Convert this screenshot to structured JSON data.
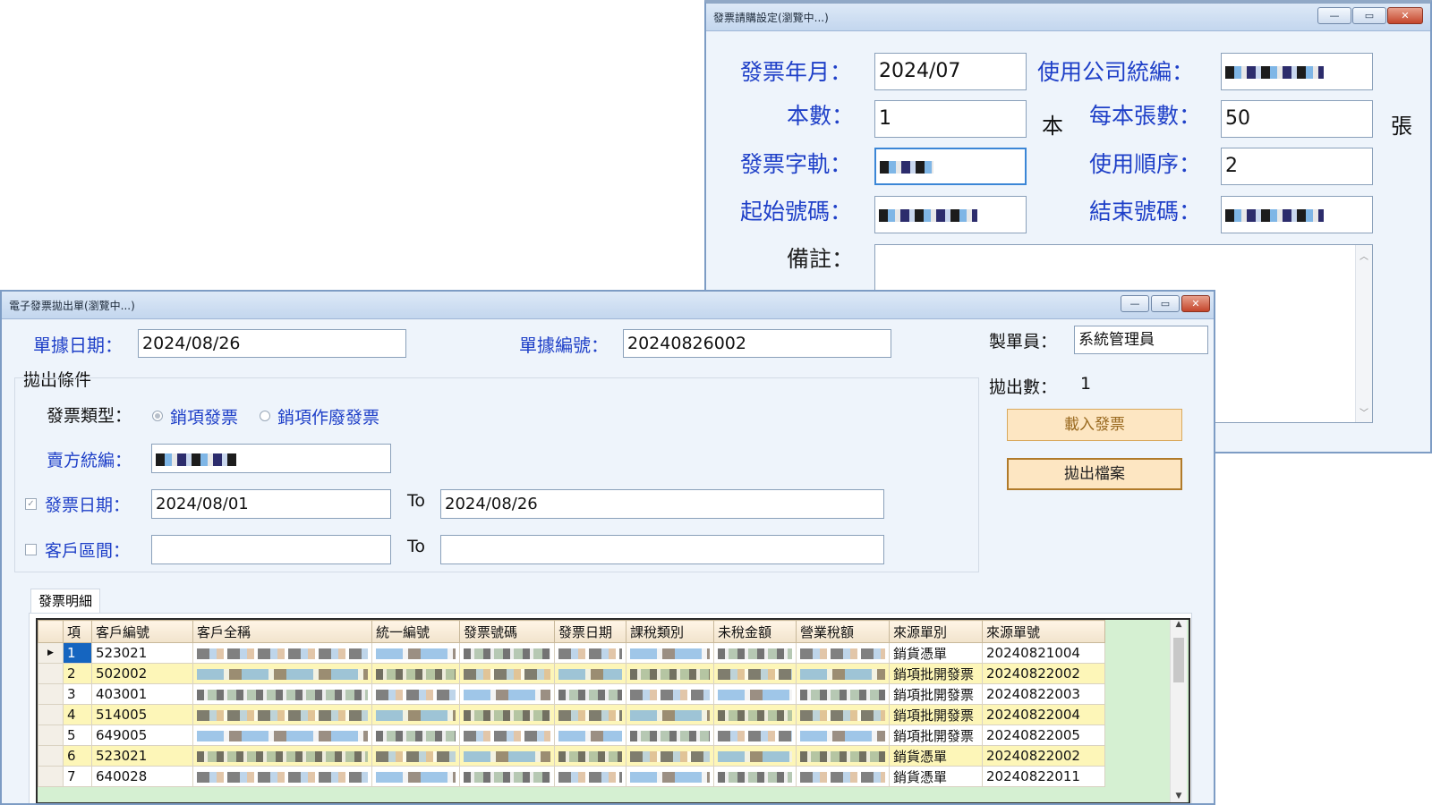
{
  "win1": {
    "title": "發票請購設定(瀏覽中...)",
    "buttons": {
      "min": "—",
      "max": "▭",
      "close": "✕"
    },
    "fields": {
      "invoice_ym_label": "發票年月：",
      "invoice_ym_value": "2024/07",
      "company_tax_label": "使用公司統編：",
      "books_label": "本數：",
      "books_value": "1",
      "books_unit": "本",
      "sheets_label": "每本張數：",
      "sheets_value": "50",
      "sheets_unit": "張",
      "track_label": "發票字軌：",
      "order_label": "使用順序：",
      "order_value": "2",
      "start_label": "起始號碼：",
      "end_label": "結束號碼：",
      "memo_label": "備註："
    }
  },
  "win2": {
    "title": "電子發票拋出單(瀏覽中...)",
    "buttons": {
      "min": "—",
      "max": "▭",
      "close": "✕"
    },
    "doc_date_label": "單據日期：",
    "doc_date_value": "2024/08/26",
    "doc_no_label": "單據編號：",
    "doc_no_value": "20240826002",
    "maker_label": "製單員：",
    "maker_value": "系統管理員",
    "group_label": "拋出條件",
    "inv_type_label": "發票類型：",
    "radio_sales": "銷項發票",
    "radio_void": "銷項作廢發票",
    "seller_tax_label": "賣方統編：",
    "inv_date_label": "發票日期：",
    "inv_date_from": "2024/08/01",
    "to1": "To",
    "inv_date_to": "2024/08/26",
    "cust_range_label": "客戶區間：",
    "to2": "To",
    "export_count_label": "拋出數：",
    "export_count_value": "1",
    "load_button": "載入發票",
    "export_button": "拋出檔案",
    "tab_label": "發票明細",
    "grid": {
      "columns": [
        "項",
        "客戶編號",
        "客戶全稱",
        "統一編號",
        "發票號碼",
        "發票日期",
        "課稅類別",
        "未稅金額",
        "營業稅額",
        "來源單別",
        "來源單號"
      ],
      "rows": [
        {
          "no": "1",
          "cust": "523021",
          "src_type": "銷貨憑單",
          "src_no": "20240821004"
        },
        {
          "no": "2",
          "cust": "502002",
          "src_type": "銷項批開發票",
          "src_no": "20240822002"
        },
        {
          "no": "3",
          "cust": "403001",
          "src_type": "銷項批開發票",
          "src_no": "20240822003"
        },
        {
          "no": "4",
          "cust": "514005",
          "src_type": "銷項批開發票",
          "src_no": "20240822004"
        },
        {
          "no": "5",
          "cust": "649005",
          "src_type": "銷項批開發票",
          "src_no": "20240822005"
        },
        {
          "no": "6",
          "cust": "523021",
          "src_type": "銷貨憑單",
          "src_no": "20240822002"
        },
        {
          "no": "7",
          "cust": "640028",
          "src_type": "銷貨憑單",
          "src_no": "20240822011"
        }
      ]
    }
  }
}
